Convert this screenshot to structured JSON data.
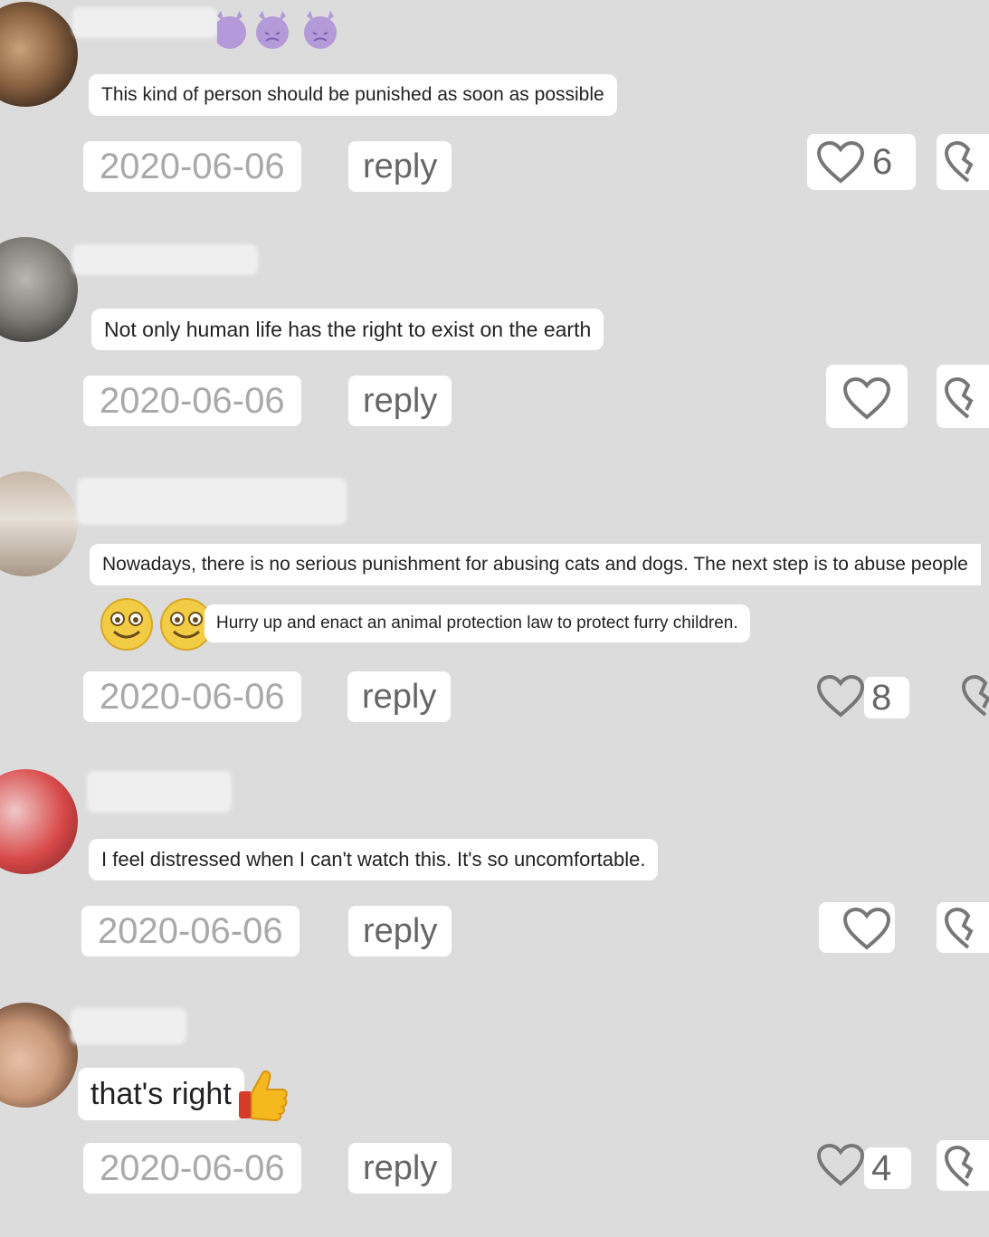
{
  "comments": [
    {
      "text": "This kind of person should be punished as soon as possible",
      "date": "2020-06-06",
      "reply_label": "reply",
      "likes": "6"
    },
    {
      "text": "Not only human life has the right to exist on the earth",
      "date": "2020-06-06",
      "reply_label": "reply",
      "likes": ""
    },
    {
      "text": "Nowadays, there is no serious punishment for abusing cats and dogs. The next step is to abuse people",
      "text2": "Hurry up and enact an animal protection law to protect furry children.",
      "date": "2020-06-06",
      "reply_label": "reply",
      "likes": "8"
    },
    {
      "text": "I feel distressed when I can't watch this. It's so uncomfortable.",
      "date": "2020-06-06",
      "reply_label": "reply",
      "likes": ""
    },
    {
      "text": "that's right",
      "date": "2020-06-06",
      "reply_label": "reply",
      "likes": "4"
    }
  ],
  "icons": {
    "like": "heart-outline-icon",
    "dislike": "broken-heart-icon",
    "emoji_devil": "purple-devil-emoji",
    "emoji_smile": "smiling-face-emoji",
    "emoji_thumbs": "thumbs-up-emoji"
  },
  "colors": {
    "background": "#dcdcdc",
    "bubble": "#ffffff",
    "date_text": "#a9a9a9",
    "devil_purple": "#b49ad8"
  }
}
